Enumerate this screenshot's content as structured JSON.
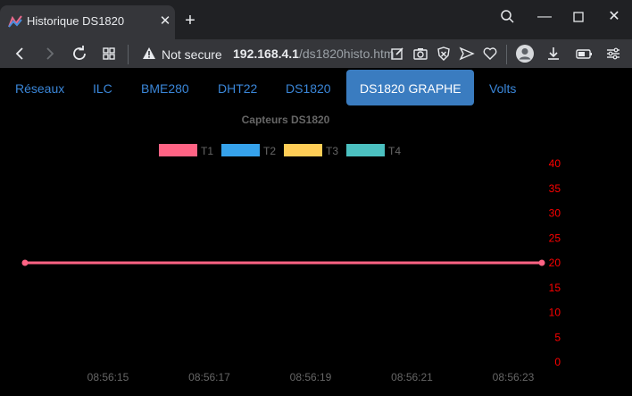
{
  "browser": {
    "tab_title": "Historique DS1820",
    "security_label": "Not secure",
    "url_host": "192.168.4.1",
    "url_path": "/ds1820histo.htm"
  },
  "nav": {
    "items": [
      {
        "label": "Réseaux"
      },
      {
        "label": "ILC"
      },
      {
        "label": "BME280"
      },
      {
        "label": "DHT22"
      },
      {
        "label": "DS1820"
      },
      {
        "label": "DS1820 GRAPHE"
      },
      {
        "label": "Volts"
      }
    ],
    "active_index": 5
  },
  "colors": {
    "T1": "#ff6384",
    "T2": "#36a2eb",
    "T3": "#ffcd56",
    "T4": "#4bc0c0",
    "axis_ticks": "#ff0000",
    "active_nav": "#3a7cc0"
  },
  "chart_data": {
    "type": "line",
    "title": "Capteurs DS1820",
    "legend_position": "top",
    "series": [
      {
        "name": "T1",
        "color": "#ff6384",
        "x": [
          "08:56:14",
          "08:56:24"
        ],
        "values": [
          20,
          20
        ]
      },
      {
        "name": "T2",
        "color": "#36a2eb",
        "values": []
      },
      {
        "name": "T3",
        "color": "#ffcd56",
        "values": []
      },
      {
        "name": "T4",
        "color": "#4bc0c0",
        "values": []
      }
    ],
    "x_ticks": [
      "08:56:15",
      "08:56:17",
      "08:56:19",
      "08:56:21",
      "08:56:23"
    ],
    "y_ticks": [
      40,
      35,
      30,
      25,
      20,
      15,
      10,
      5,
      0
    ],
    "ylim": [
      0,
      40
    ],
    "y_axis_side": "right",
    "grid": false
  }
}
